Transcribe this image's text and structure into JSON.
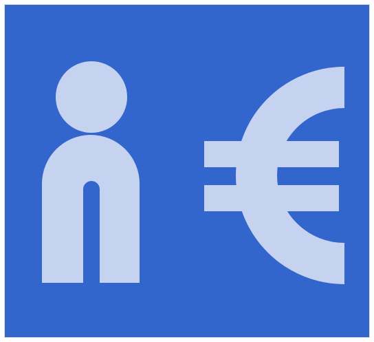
{
  "icon": {
    "name": "info-euro-icon",
    "parts": [
      "info-i-icon",
      "euro-sign-icon"
    ]
  },
  "colors": {
    "background": "#3366cc",
    "glyph": "#c5d3f0",
    "page": "#ffffff"
  }
}
